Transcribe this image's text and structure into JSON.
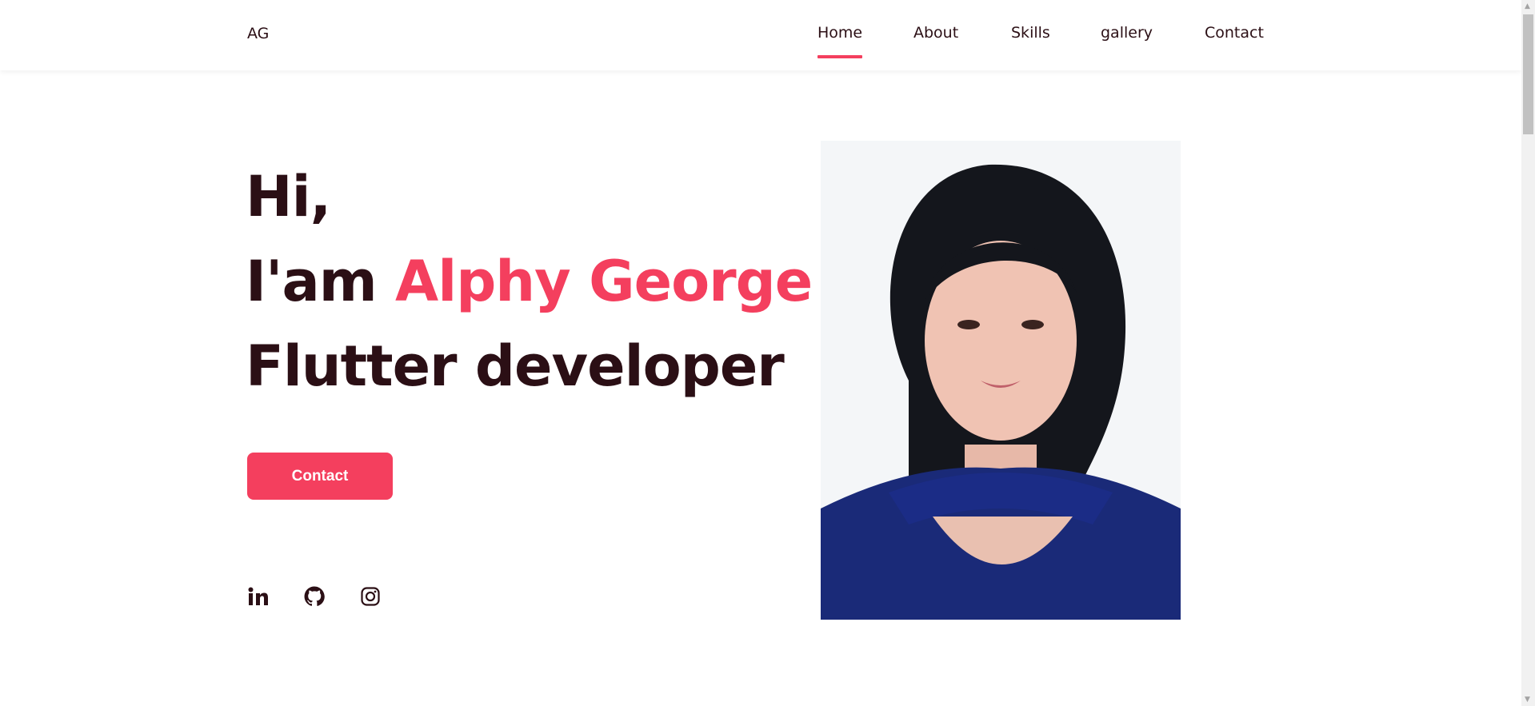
{
  "nav": {
    "logo": "AG",
    "items": [
      {
        "label": "Home",
        "active": true
      },
      {
        "label": "About"
      },
      {
        "label": "Skills"
      },
      {
        "label": "gallery"
      },
      {
        "label": "Contact"
      }
    ]
  },
  "hero": {
    "greeting": "Hi,",
    "intro_prefix": "I'am ",
    "name": "Alphy George",
    "role": "Flutter developer",
    "contact_button": "Contact",
    "socials": [
      "linkedin-icon",
      "github-icon",
      "instagram-icon"
    ]
  },
  "colors": {
    "accent": "#f43f5e",
    "text": "#2b0f15"
  }
}
